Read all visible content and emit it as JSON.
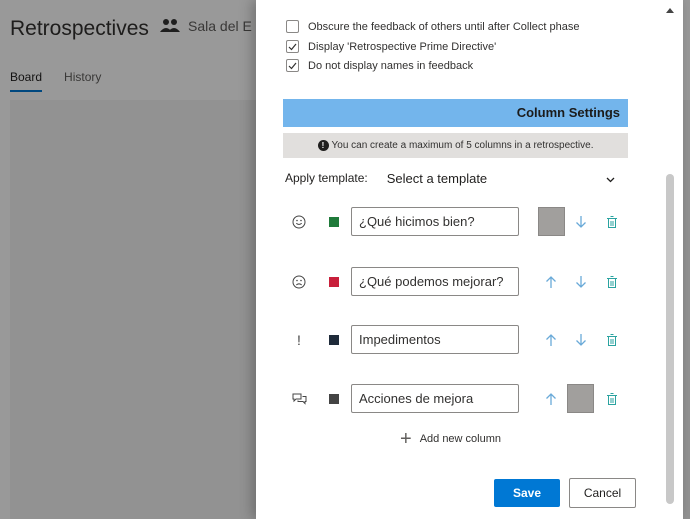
{
  "background": {
    "title": "Retrospectives",
    "team": "Sala del E",
    "tabs": [
      "Board",
      "History"
    ]
  },
  "options": [
    {
      "label": "Obscure the feedback of others until after Collect phase",
      "checked": false
    },
    {
      "label": "Display 'Retrospective Prime Directive'",
      "checked": true
    },
    {
      "label": "Do not display names in feedback",
      "checked": true
    }
  ],
  "column_settings": {
    "title": "Column Settings",
    "info": "You can create a maximum of 5 columns in a retrospective.",
    "template_label": "Apply template:",
    "template_value": "Select a template",
    "columns": [
      {
        "icon": "smile-icon",
        "color": "#1f7a3a",
        "name": "¿Qué hicimos bien?"
      },
      {
        "icon": "sad-icon",
        "color": "#c8203b",
        "name": "¿Qué podemos mejorar?"
      },
      {
        "icon": "exclamation-icon",
        "color": "#1f2b3a",
        "name": "Impedimentos"
      },
      {
        "icon": "chat-icon",
        "color": "#444444",
        "name": "Acciones de mejora"
      }
    ],
    "add_column": "Add new column"
  },
  "footer": {
    "save": "Save",
    "cancel": "Cancel"
  },
  "colors": {
    "accent": "#0078d4",
    "header_band": "#73b5ec",
    "icon_teal": "#2aa3a0",
    "arrow_blue": "#6aaad8"
  }
}
